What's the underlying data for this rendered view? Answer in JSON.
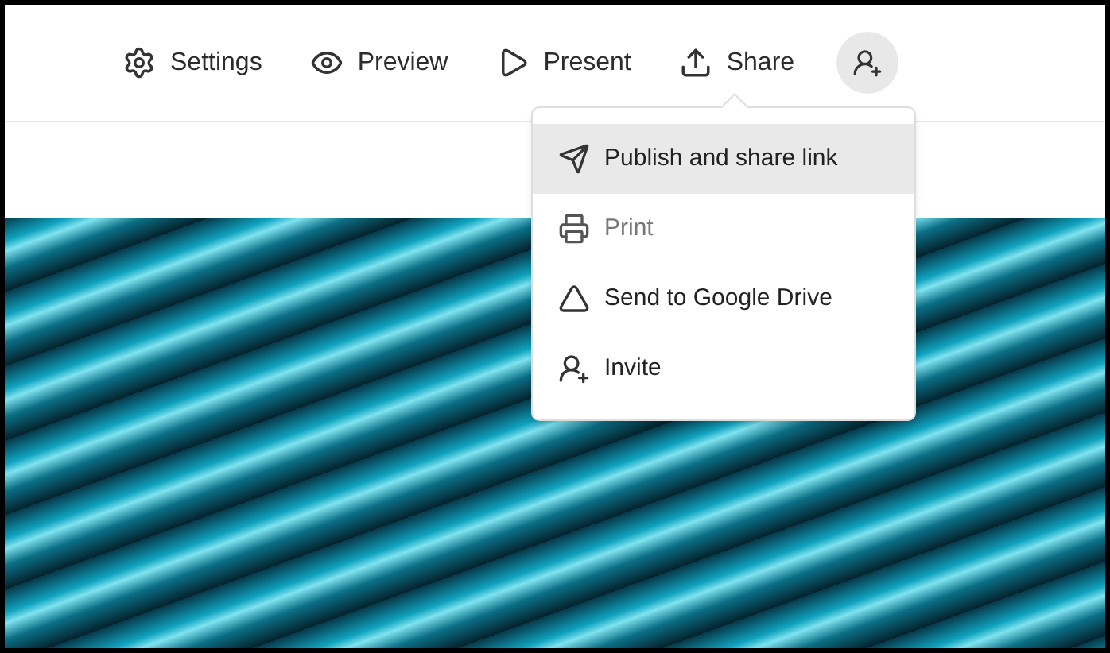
{
  "toolbar": {
    "items": [
      {
        "kind": "settings",
        "label": "Settings"
      },
      {
        "kind": "preview",
        "label": "Preview"
      },
      {
        "kind": "present",
        "label": "Present"
      },
      {
        "kind": "share",
        "label": "Share"
      }
    ],
    "invite_button": {
      "kind": "invite"
    }
  },
  "share_menu": {
    "items": [
      {
        "kind": "publish",
        "label": "Publish and share link",
        "selected": true,
        "disabled": false
      },
      {
        "kind": "print",
        "label": "Print",
        "selected": false,
        "disabled": true
      },
      {
        "kind": "drive",
        "label": "Send to Google Drive",
        "selected": false,
        "disabled": false
      },
      {
        "kind": "invite",
        "label": "Invite",
        "selected": false,
        "disabled": false
      }
    ]
  }
}
